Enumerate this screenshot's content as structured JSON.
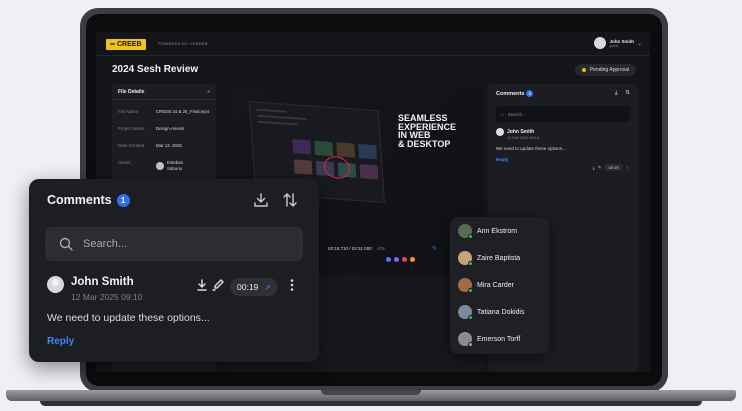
{
  "app": {
    "logo_text": "CREEB",
    "powered_by": "POWERED BY ∞CREEB",
    "page_title": "2024 Sesh Review",
    "status": "Pending Approval",
    "user": {
      "name": "John Smith",
      "role": "guest"
    }
  },
  "file_details": {
    "title": "File Details",
    "collapse_icon": "double-chevron-left-icon",
    "rows": [
      {
        "label": "File Name",
        "value": "CREEB 24 & 25_Final.mp4"
      },
      {
        "label": "Project Name",
        "value": "Design-Assets"
      },
      {
        "label": "Date Created",
        "value": "Mar 12, 2025"
      },
      {
        "label": "Owner",
        "value": "Esteban Saborio"
      }
    ]
  },
  "video": {
    "headline_lines": [
      "SEAMLESS",
      "EXPERIENCE",
      "IN WEB",
      "& DESKTOP"
    ],
    "timecode": "00:18.710 / 02:31.000",
    "fps": "479",
    "control_colors": [
      "#3b82f6",
      "#8b5cf6",
      "#ef4444",
      "#f59e0b"
    ]
  },
  "side_comments": {
    "title": "Comments",
    "count": "1",
    "search_placeholder": "Search...",
    "author": "John Smith",
    "date": "12 Mar 2025 09:10",
    "time": "00:19",
    "text": "We need to update these options...",
    "reply": "Reply"
  },
  "comments_card": {
    "title": "Comments",
    "count": "1",
    "search_placeholder": "Search...",
    "comment": {
      "author": "John Smith",
      "date": "12 Mar 2025 09:10",
      "time": "00:19",
      "text": "We need to update these options...",
      "reply": "Reply"
    }
  },
  "mentions": [
    {
      "name": "Ann Ekstrom",
      "avatar_color": "#5b6b4f",
      "status_color": "#22c55e"
    },
    {
      "name": "Zaire Baptista",
      "avatar_color": "#c8a27a",
      "status_color": "#22c55e"
    },
    {
      "name": "Mira Carder",
      "avatar_color": "#a06b45",
      "status_color": "#22c55e"
    },
    {
      "name": "Tatiana Dokidis",
      "avatar_color": "#7b8aa0",
      "status_color": "#22c55e"
    },
    {
      "name": "Emerson Torff",
      "avatar_color": "#8c8c90",
      "status_color": "#9ca3af"
    }
  ],
  "colors": {
    "accent": "#3c86ff",
    "badge": "#2f6ef5",
    "logo": "#f3c317",
    "annotation": "#e02b3a"
  }
}
